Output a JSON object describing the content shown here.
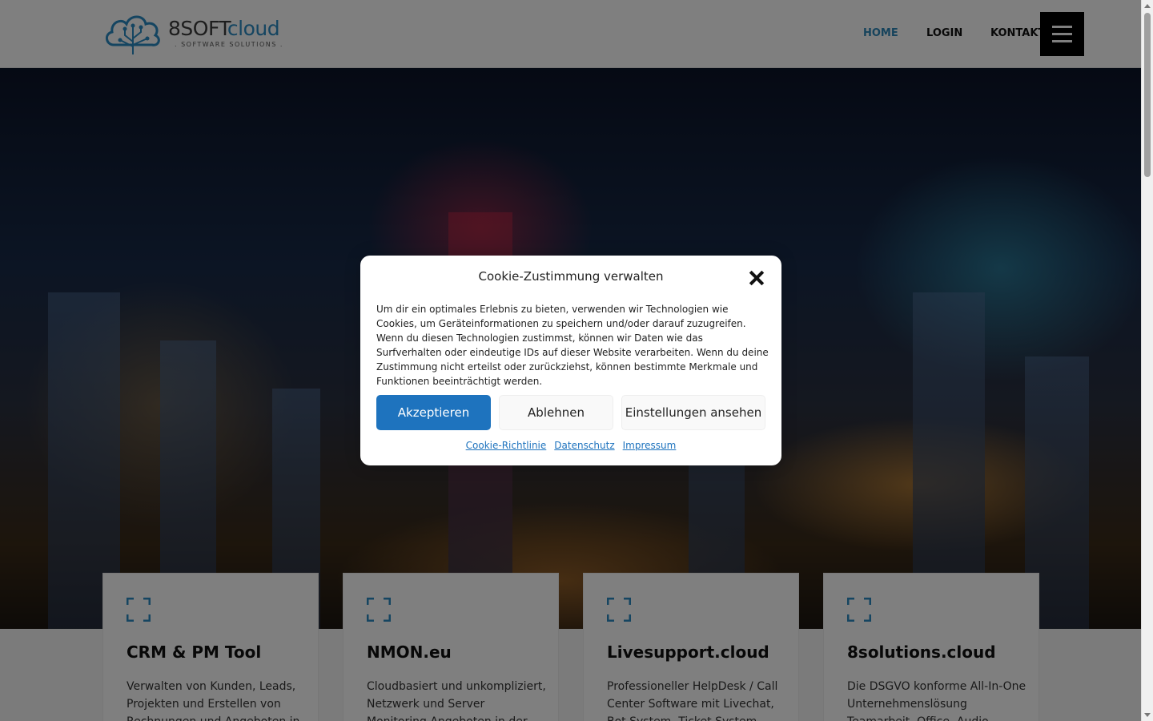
{
  "header": {
    "logo": {
      "brand_main": "8SOFT",
      "brand_accent": "cloud",
      "tagline": ". SOFTWARE SOLUTIONS ."
    },
    "nav": [
      {
        "label": "HOME",
        "active": true
      },
      {
        "label": "LOGIN",
        "active": false
      },
      {
        "label": "KONTAKT",
        "active": false
      }
    ],
    "menu_icon": "hamburger-icon"
  },
  "cards": [
    {
      "icon": "expand-icon",
      "title": "CRM & PM Tool",
      "text": "Verwalten von Kunden, Leads, Projekten und Erstellen von Rechnungen und Angeboten in"
    },
    {
      "icon": "expand-icon",
      "title": "NMON.eu",
      "text": "Cloudbasiert und unkompliziert, Netzwerk und Server Monitoring Angeboten in der"
    },
    {
      "icon": "expand-icon",
      "title": "Livesupport.cloud",
      "text": "Professioneller HelpDesk / Call Center Software mit Livechat, Bot System, Ticket System"
    },
    {
      "icon": "expand-icon",
      "title": "8solutions.cloud",
      "text": "Die DSGVO konforme All-In-One Unternehmenslösung Teamarbeit, Office, Audio-"
    }
  ],
  "cookie_dialog": {
    "title": "Cookie-Zustimmung verwalten",
    "close_icon": "close-icon",
    "body": "Um dir ein optimales Erlebnis zu bieten, verwenden wir Technologien wie Cookies, um Geräteinformationen zu speichern und/oder darauf zuzugreifen. Wenn du diesen Technologien zustimmst, können wir Daten wie das Surfverhalten oder eindeutige IDs auf dieser Website verarbeiten. Wenn du deine Zustimmung nicht erteilst oder zurückziehst, können bestimmte Merkmale und Funktionen beeinträchtigt werden.",
    "buttons": {
      "accept": "Akzeptieren",
      "deny": "Ablehnen",
      "settings": "Einstellungen ansehen"
    },
    "links": [
      "Cookie-Richtlinie",
      "Datenschutz",
      "Impressum"
    ]
  },
  "colors": {
    "accent": "#1e73be",
    "nav_active": "#2d87b8",
    "logo_blue": "#2a8bc2"
  }
}
